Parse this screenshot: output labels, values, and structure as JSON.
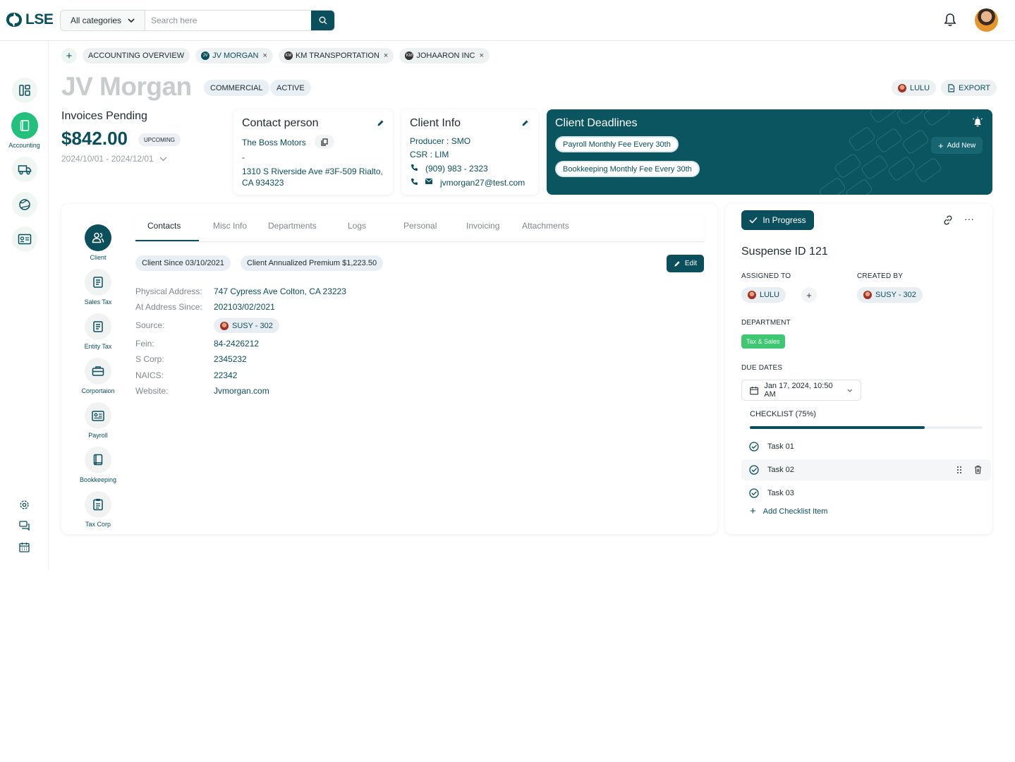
{
  "brand": {
    "name": "LSE"
  },
  "search": {
    "category": "All categories",
    "placeholder": "Search here"
  },
  "sidebar": {
    "items": [
      {
        "label": ""
      },
      {
        "label": "Accounting"
      },
      {
        "label": ""
      },
      {
        "label": ""
      },
      {
        "label": ""
      }
    ]
  },
  "tabs": {
    "items": [
      {
        "label": "ACCOUNTING OVERVIEW"
      },
      {
        "label": "JV MORGAN",
        "badge": "JV"
      },
      {
        "label": "KM TRANSPORTATION",
        "badge": "KM"
      },
      {
        "label": "JOHAARON INC",
        "badge": "KM"
      }
    ]
  },
  "header": {
    "name": "JV Morgan",
    "chips": [
      "COMMERCIAL",
      "ACTIVE"
    ],
    "user_chip": "LULU",
    "export_label": "EXPORT"
  },
  "invoices": {
    "title": "Invoices Pending",
    "amount": "$842.00",
    "badge": "UPCOMING",
    "range": "2024/10/01 - 2024/12/01"
  },
  "contact": {
    "title": "Contact person",
    "company": "The Boss Motors",
    "dash": "-",
    "address": "1310 S Riverside Ave #3F-509 Rialto, CA 934323"
  },
  "client_info": {
    "title": "Client Info",
    "producer": "Producer : SMO",
    "csr": "CSR : LIM",
    "phone": "(909) 983 - 2323",
    "email": "jvmorgan27@test.com"
  },
  "deadlines": {
    "title": "Client Deadlines",
    "items": [
      "Payroll Monthly Fee Every 30th",
      "Bookkeeping Monthly Fee Every 30th"
    ],
    "add_label": "Add New"
  },
  "side_nav": [
    {
      "label": "Client"
    },
    {
      "label": "Sales Tax"
    },
    {
      "label": "Entity Tax"
    },
    {
      "label": "Corportaion"
    },
    {
      "label": "Payroll"
    },
    {
      "label": "Bookkeeping"
    },
    {
      "label": "Tax Corp"
    }
  ],
  "content_tabs": [
    "Contacts",
    "Misc Info",
    "Departments",
    "Logs",
    "Personal",
    "Invoicing",
    "Attachments"
  ],
  "info_pills": [
    "Client Since 03/10/2021",
    "Client Annualized Premium $1,223.50"
  ],
  "edit_label": "Edit",
  "fields": [
    {
      "label": "Physical Address:",
      "value": "747 Cypress Ave Colton, CA 23223"
    },
    {
      "label": "At Address Since:",
      "value": "202103/02/2021"
    },
    {
      "label": "Source:",
      "value": "SUSY - 302"
    },
    {
      "label": "Fein:",
      "value": "84-2426212"
    },
    {
      "label": "S Corp:",
      "value": "2345232"
    },
    {
      "label": "NAICS:",
      "value": "22342"
    },
    {
      "label": "Website:",
      "value": "Jvmorgan.com"
    }
  ],
  "task": {
    "status": "In Progress",
    "title": "Suspense ID 121",
    "assigned_label": "ASSIGNED TO",
    "assigned_to": "LULU",
    "created_label": "CREATED BY",
    "created_by": "SUSY - 302",
    "department_label": "DEPARTMENT",
    "department": "Tax & Sales",
    "due_label": "DUE DATES",
    "due_date": "Jan 17, 2024, 10:50 AM",
    "checklist_label": "CHECKLIST (75%)",
    "checklist_progress": 0.75,
    "items": [
      "Task 01",
      "Task 02",
      "Task 03"
    ],
    "add_label": "Add Checklist Item"
  },
  "colors": {
    "accent": "#0b4f5c",
    "active_nav": "#22c07a",
    "department": "#3fc773"
  }
}
